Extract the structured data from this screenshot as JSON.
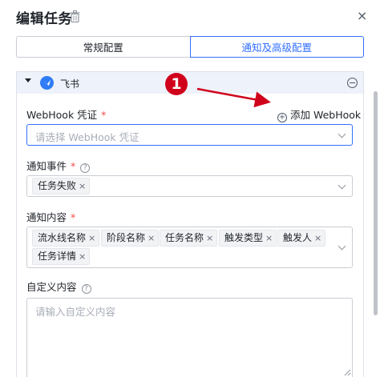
{
  "header": {
    "title": "编辑任务",
    "close_glyph": "×",
    "icons": [
      "trash-icon",
      "close-icon"
    ]
  },
  "tabs": [
    {
      "label": "常规配置",
      "active": false
    },
    {
      "label": "通知及高级配置",
      "active": true
    }
  ],
  "panel": {
    "title": "飞书",
    "icons": [
      "caret-down-icon",
      "feishu-logo-icon",
      "collapse-minus-icon"
    ],
    "header_bg": "#eef2fa"
  },
  "webhook": {
    "label": "WebHook 凭证",
    "required_mark": "*",
    "add_label": "添加 WebHook",
    "add_glyph": "+",
    "placeholder": "请选择 WebHook 凭证"
  },
  "event": {
    "label": "通知事件",
    "required_mark": "*",
    "help_glyph": "?",
    "tags": [
      {
        "label": "任务失败"
      }
    ]
  },
  "content": {
    "label": "通知内容",
    "required_mark": "*",
    "tags": [
      {
        "label": "流水线名称"
      },
      {
        "label": "阶段名称"
      },
      {
        "label": "任务名称"
      },
      {
        "label": "触发类型"
      },
      {
        "label": "触发人"
      },
      {
        "label": "任务详情"
      }
    ]
  },
  "custom": {
    "label": "自定义内容",
    "help_glyph": "?",
    "placeholder": "请输入自定义内容"
  },
  "annotation": {
    "number": "1",
    "color": "#d0021b"
  },
  "colors": {
    "primary": "#3370ff",
    "required": "#f54a45",
    "border": "#c9cdd4"
  },
  "tag_close_glyph": "×"
}
